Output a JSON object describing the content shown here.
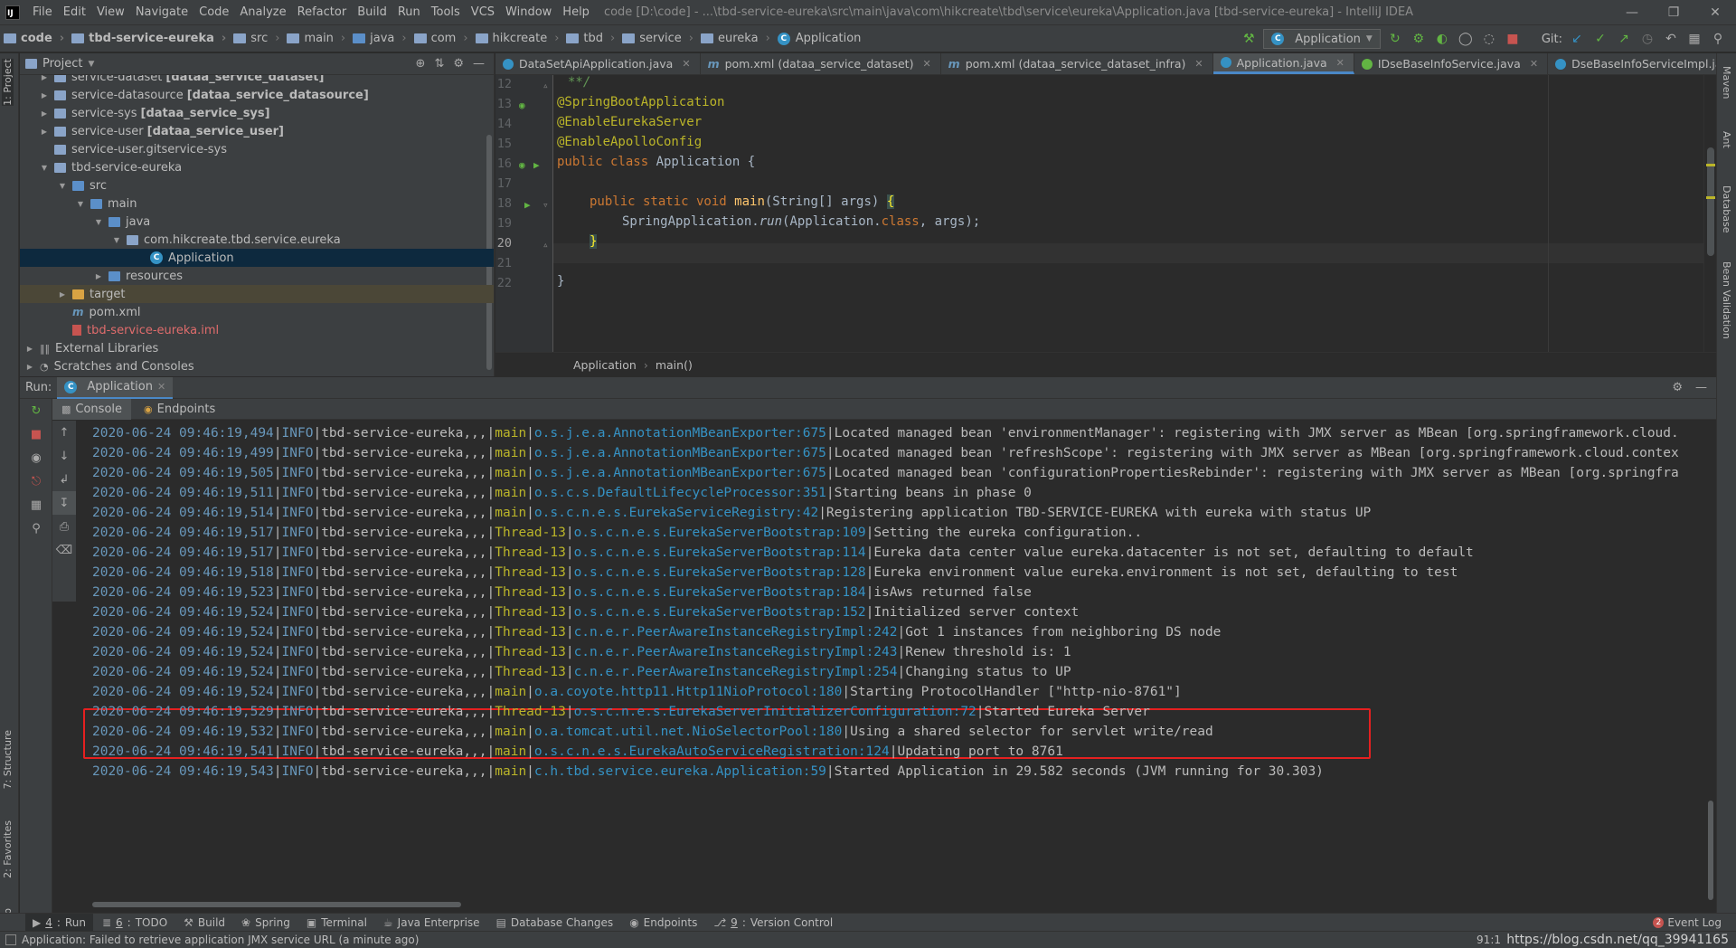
{
  "window": {
    "title": "code [D:\\code] - ...\\tbd-service-eureka\\src\\main\\java\\com\\hikcreate\\tbd\\service\\eureka\\Application.java [tbd-service-eureka] - IntelliJ IDEA",
    "menu": [
      "File",
      "Edit",
      "View",
      "Navigate",
      "Code",
      "Analyze",
      "Refactor",
      "Build",
      "Run",
      "Tools",
      "VCS",
      "Window",
      "Help"
    ]
  },
  "breadcrumbs": [
    "code",
    "tbd-service-eureka",
    "src",
    "main",
    "java",
    "com",
    "hikcreate",
    "tbd",
    "service",
    "eureka",
    "Application"
  ],
  "toolbar": {
    "run_config": "Application",
    "git_label": "Git:"
  },
  "left_strip": {
    "project": "1: Project",
    "structure": "7: Structure",
    "favorites": "2: Favorites",
    "web": "Web"
  },
  "right_strip": [
    "Maven",
    "Ant",
    "Database",
    "Bean Validation"
  ],
  "project_panel": {
    "title": "Project",
    "items": [
      {
        "label": "service-dataset",
        "module": "[dataa_service_dataset]"
      },
      {
        "label": "service-datasource",
        "module": "[dataa_service_datasource]"
      },
      {
        "label": "service-sys",
        "module": "[dataa_service_sys]"
      },
      {
        "label": "service-user",
        "module": "[dataa_service_user]"
      },
      {
        "label": "service-user.gitservice-sys",
        "module": ""
      },
      {
        "label": "tbd-service-eureka",
        "module": ""
      },
      {
        "label": "src",
        "module": ""
      },
      {
        "label": "main",
        "module": ""
      },
      {
        "label": "java",
        "module": ""
      },
      {
        "label": "com.hikcreate.tbd.service.eureka",
        "module": ""
      },
      {
        "label": "Application",
        "module": ""
      },
      {
        "label": "resources",
        "module": ""
      },
      {
        "label": "target",
        "module": ""
      },
      {
        "label": "pom.xml",
        "module": ""
      },
      {
        "label": "tbd-service-eureka.iml",
        "module": ""
      },
      {
        "label": "External Libraries",
        "module": ""
      },
      {
        "label": "Scratches and Consoles",
        "module": ""
      }
    ]
  },
  "editor": {
    "tabs": [
      {
        "label": "DataSetApiApplication.java",
        "icon": "class-icon"
      },
      {
        "label": "pom.xml (dataa_service_dataset)",
        "icon": "maven-icon"
      },
      {
        "label": "pom.xml (dataa_service_dataset_infra)",
        "icon": "maven-icon"
      },
      {
        "label": "Application.java",
        "icon": "class-icon"
      },
      {
        "label": "IDseBaseInfoService.java",
        "icon": "interface-icon"
      },
      {
        "label": "DseBaseInfoServiceImpl.java",
        "icon": "class-icon"
      },
      {
        "label": "D",
        "icon": "class-icon"
      }
    ],
    "line_numbers": [
      "12",
      "13",
      "14",
      "15",
      "16",
      "17",
      "18",
      "19",
      "20",
      "21",
      "22"
    ],
    "code": {
      "l12": "**/",
      "l13": "@SpringBootApplication",
      "l14": "@EnableEurekaServer",
      "l15": "@EnableApolloConfig",
      "l16_kw": "public class ",
      "l16_name": "Application {",
      "l18_kw": "public static void ",
      "l18_fn": "main",
      "l18_rest": "(String[] args) ",
      "l18_brace": "{",
      "l19_a": "SpringApplication.",
      "l19_fn": "run",
      "l19_b": "(Application.",
      "l19_kw": "class",
      "l19_c": ", args);",
      "l20": "}",
      "l22": "}"
    },
    "crumbs": [
      "Application",
      "main()"
    ]
  },
  "run_panel": {
    "label": "Run:",
    "config": "Application",
    "subtabs": [
      "Console",
      "Endpoints"
    ],
    "log": [
      {
        "ts": "2020-06-24 09:46:19,494",
        "lv": "INFO",
        "svc": "tbd-service-eureka,,,",
        "th": "main",
        "lg": "o.s.j.e.a.AnnotationMBeanExporter:675",
        "msg": "Located managed bean 'environmentManager': registering with JMX server as MBean [org.springframework.cloud."
      },
      {
        "ts": "2020-06-24 09:46:19,499",
        "lv": "INFO",
        "svc": "tbd-service-eureka,,,",
        "th": "main",
        "lg": "o.s.j.e.a.AnnotationMBeanExporter:675",
        "msg": "Located managed bean 'refreshScope': registering with JMX server as MBean [org.springframework.cloud.contex"
      },
      {
        "ts": "2020-06-24 09:46:19,505",
        "lv": "INFO",
        "svc": "tbd-service-eureka,,,",
        "th": "main",
        "lg": "o.s.j.e.a.AnnotationMBeanExporter:675",
        "msg": "Located managed bean 'configurationPropertiesRebinder': registering with JMX server as MBean [org.springfra"
      },
      {
        "ts": "2020-06-24 09:46:19,511",
        "lv": "INFO",
        "svc": "tbd-service-eureka,,,",
        "th": "main",
        "lg": "o.s.c.s.DefaultLifecycleProcessor:351",
        "msg": "Starting beans in phase 0"
      },
      {
        "ts": "2020-06-24 09:46:19,514",
        "lv": "INFO",
        "svc": "tbd-service-eureka,,,",
        "th": "main",
        "lg": "o.s.c.n.e.s.EurekaServiceRegistry:42",
        "msg": "Registering application TBD-SERVICE-EUREKA with eureka with status UP"
      },
      {
        "ts": "2020-06-24 09:46:19,517",
        "lv": "INFO",
        "svc": "tbd-service-eureka,,,",
        "th": "Thread-13",
        "lg": "o.s.c.n.e.s.EurekaServerBootstrap:109",
        "msg": "Setting the eureka configuration.."
      },
      {
        "ts": "2020-06-24 09:46:19,517",
        "lv": "INFO",
        "svc": "tbd-service-eureka,,,",
        "th": "Thread-13",
        "lg": "o.s.c.n.e.s.EurekaServerBootstrap:114",
        "msg": "Eureka data center value eureka.datacenter is not set, defaulting to default"
      },
      {
        "ts": "2020-06-24 09:46:19,518",
        "lv": "INFO",
        "svc": "tbd-service-eureka,,,",
        "th": "Thread-13",
        "lg": "o.s.c.n.e.s.EurekaServerBootstrap:128",
        "msg": "Eureka environment value eureka.environment is not set, defaulting to test"
      },
      {
        "ts": "2020-06-24 09:46:19,523",
        "lv": "INFO",
        "svc": "tbd-service-eureka,,,",
        "th": "Thread-13",
        "lg": "o.s.c.n.e.s.EurekaServerBootstrap:184",
        "msg": "isAws returned false"
      },
      {
        "ts": "2020-06-24 09:46:19,524",
        "lv": "INFO",
        "svc": "tbd-service-eureka,,,",
        "th": "Thread-13",
        "lg": "o.s.c.n.e.s.EurekaServerBootstrap:152",
        "msg": "Initialized server context"
      },
      {
        "ts": "2020-06-24 09:46:19,524",
        "lv": "INFO",
        "svc": "tbd-service-eureka,,,",
        "th": "Thread-13",
        "lg": "c.n.e.r.PeerAwareInstanceRegistryImpl:242",
        "msg": "Got 1 instances from neighboring DS node"
      },
      {
        "ts": "2020-06-24 09:46:19,524",
        "lv": "INFO",
        "svc": "tbd-service-eureka,,,",
        "th": "Thread-13",
        "lg": "c.n.e.r.PeerAwareInstanceRegistryImpl:243",
        "msg": "Renew threshold is: 1"
      },
      {
        "ts": "2020-06-24 09:46:19,524",
        "lv": "INFO",
        "svc": "tbd-service-eureka,,,",
        "th": "Thread-13",
        "lg": "c.n.e.r.PeerAwareInstanceRegistryImpl:254",
        "msg": "Changing status to UP"
      },
      {
        "ts": "2020-06-24 09:46:19,524",
        "lv": "INFO",
        "svc": "tbd-service-eureka,,,",
        "th": "main",
        "lg": "o.a.coyote.http11.Http11NioProtocol:180",
        "msg": "Starting ProtocolHandler [\"http-nio-8761\"]"
      },
      {
        "ts": "2020-06-24 09:46:19,529",
        "lv": "INFO",
        "svc": "tbd-service-eureka,,,",
        "th": "Thread-13",
        "lg": "o.s.c.n.e.s.EurekaServerInitializerConfiguration:72",
        "msg": "Started Eureka Server"
      },
      {
        "ts": "2020-06-24 09:46:19,532",
        "lv": "INFO",
        "svc": "tbd-service-eureka,,,",
        "th": "main",
        "lg": "o.a.tomcat.util.net.NioSelectorPool:180",
        "msg": "Using a shared selector for servlet write/read"
      },
      {
        "ts": "2020-06-24 09:46:19,541",
        "lv": "INFO",
        "svc": "tbd-service-eureka,,,",
        "th": "main",
        "lg": "o.s.c.n.e.s.EurekaAutoServiceRegistration:124",
        "msg": "Updating port to 8761"
      },
      {
        "ts": "2020-06-24 09:46:19,543",
        "lv": "INFO",
        "svc": "tbd-service-eureka,,,",
        "th": "main",
        "lg": "c.h.tbd.service.eureka.Application:59",
        "msg": "Started Application in 29.582 seconds (JVM running for 30.303)"
      }
    ]
  },
  "bottom_tabs": [
    {
      "num": "4",
      "label": "Run"
    },
    {
      "num": "6",
      "label": "TODO"
    },
    {
      "num": "",
      "label": "Build"
    },
    {
      "num": "",
      "label": "Spring"
    },
    {
      "num": "",
      "label": "Terminal"
    },
    {
      "num": "",
      "label": "Java Enterprise"
    },
    {
      "num": "",
      "label": "Database Changes"
    },
    {
      "num": "",
      "label": "Endpoints"
    },
    {
      "num": "9",
      "label": "Version Control"
    }
  ],
  "event_log": {
    "count": "2",
    "label": "Event Log"
  },
  "status": {
    "message": "Application: Failed to retrieve application JMX service URL (a minute ago)",
    "position": "91:1",
    "watermark": "https://blog.csdn.net/qq_39941165"
  },
  "colors": {
    "highlight_box": "#e52020",
    "accent": "#4a88c7",
    "timestamp": "#6897bb",
    "thread": "#bbb529",
    "logger": "#3592c4"
  }
}
